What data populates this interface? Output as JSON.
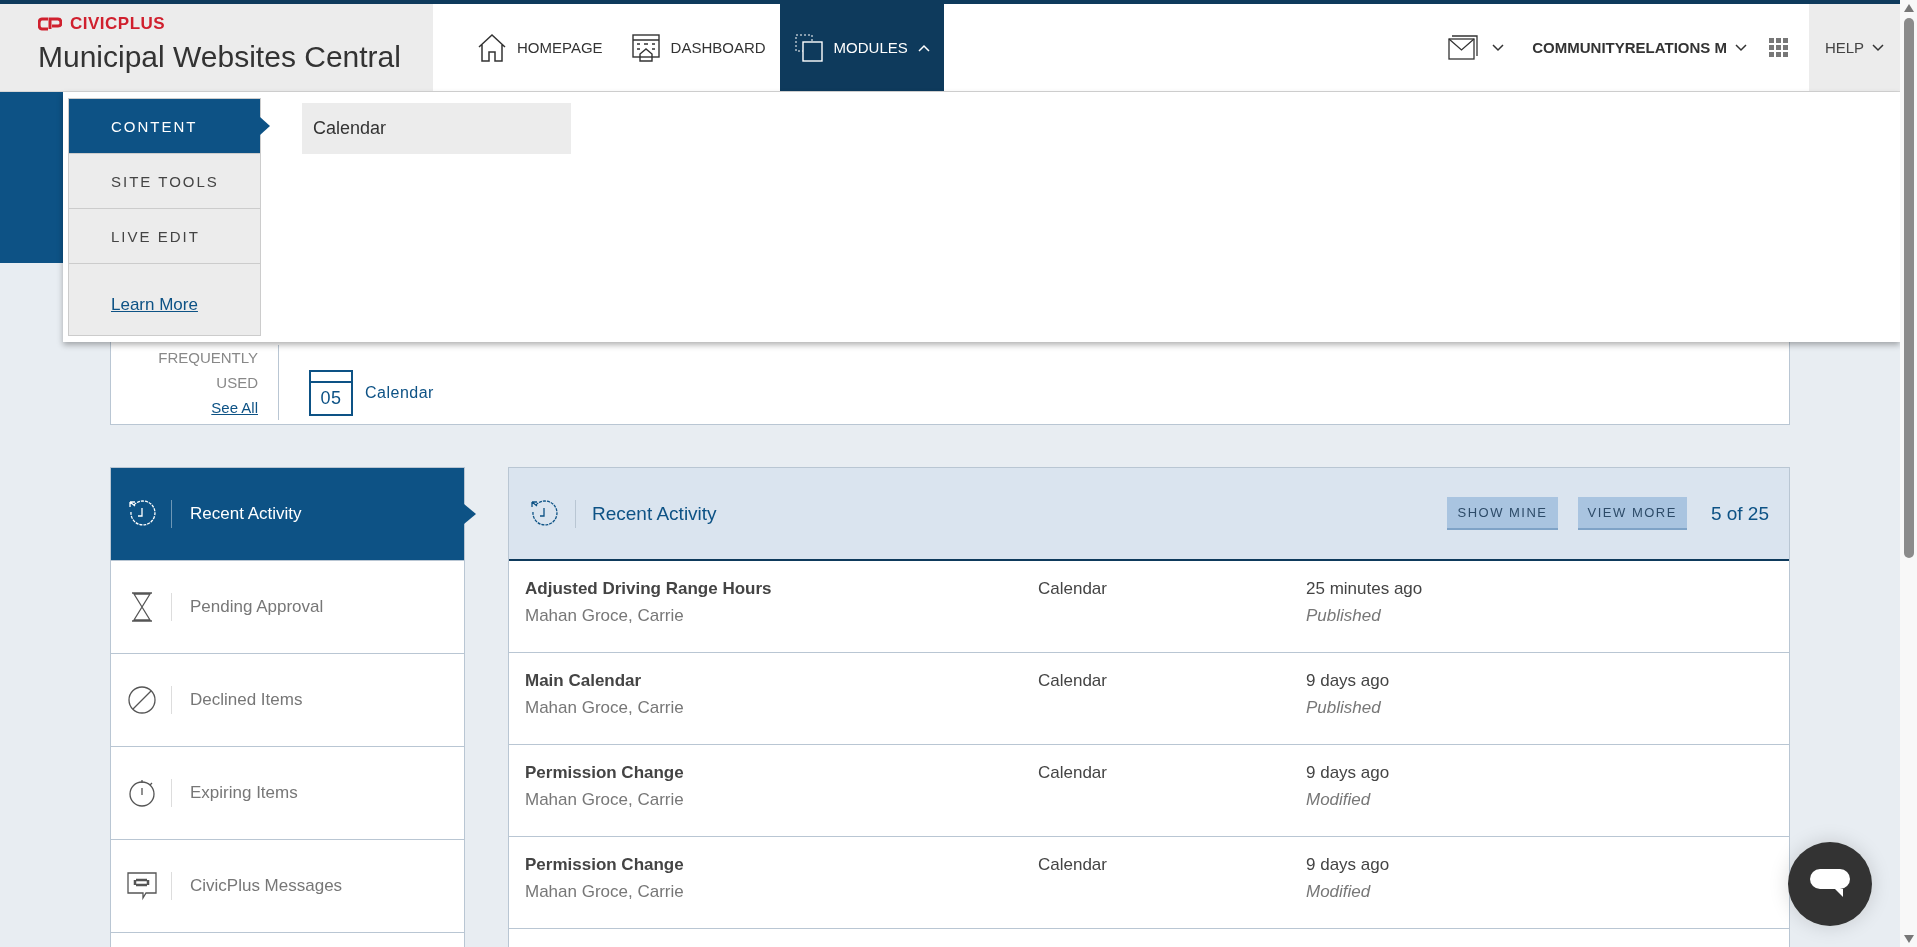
{
  "header": {
    "brand": "CIVICPLUS",
    "site_title": "Municipal Websites Central",
    "nav": [
      {
        "label": "HOMEPAGE",
        "kind": "house",
        "selected": false,
        "expanded": false
      },
      {
        "label": "DASHBOARD",
        "kind": "building",
        "selected": false,
        "expanded": false
      },
      {
        "label": "MODULES",
        "kind": "modules",
        "selected": true,
        "expanded": true
      }
    ],
    "user": "COMMUNITYRELATIONS M",
    "help": "HELP"
  },
  "modules_menu": {
    "categories": [
      {
        "label": "CONTENT",
        "selected": true
      },
      {
        "label": "SITE TOOLS",
        "selected": false
      },
      {
        "label": "LIVE EDIT",
        "selected": false
      }
    ],
    "link": "Learn More",
    "items": [
      "Calendar"
    ]
  },
  "frequently_used": {
    "label_lines": [
      "FREQUENTLY",
      "USED"
    ],
    "link": "See All",
    "items": [
      {
        "day": "05",
        "label": "Calendar"
      }
    ]
  },
  "sidebar": [
    {
      "label": "Recent Activity",
      "kind": "clock",
      "selected": true
    },
    {
      "label": "Pending Approval",
      "kind": "hourglass",
      "selected": false
    },
    {
      "label": "Declined Items",
      "kind": "declined",
      "selected": false
    },
    {
      "label": "Expiring Items",
      "kind": "stopwatch",
      "selected": false
    },
    {
      "label": "CivicPlus Messages",
      "kind": "message",
      "selected": false
    }
  ],
  "activity": {
    "title": "Recent Activity",
    "buttons": [
      "SHOW MINE",
      "VIEW MORE"
    ],
    "count": "5 of 25",
    "rows": [
      {
        "title": "Adjusted Driving Range Hours",
        "author": "Mahan Groce, Carrie",
        "module": "Calendar",
        "time": "25 minutes ago",
        "status": "Published"
      },
      {
        "title": "Main Calendar",
        "author": "Mahan Groce, Carrie",
        "module": "Calendar",
        "time": "9 days ago",
        "status": "Published"
      },
      {
        "title": "Permission Change",
        "author": "Mahan Groce, Carrie",
        "module": "Calendar",
        "time": "9 days ago",
        "status": "Modified"
      },
      {
        "title": "Permission Change",
        "author": "Mahan Groce, Carrie",
        "module": "Calendar",
        "time": "9 days ago",
        "status": "Modified"
      }
    ]
  }
}
